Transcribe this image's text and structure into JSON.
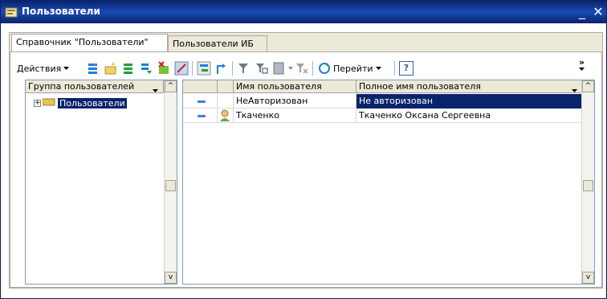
{
  "window": {
    "title": "Пользователи",
    "minimize": "_",
    "close": "✕"
  },
  "tabs": [
    {
      "label": "Справочник \"Пользователи\"",
      "active": true
    },
    {
      "label": "Пользователи ИБ",
      "active": false
    }
  ],
  "toolbar": {
    "actions_label": "Действия",
    "goto_label": "Перейти",
    "help_label": "?",
    "overflow": "»",
    "icons": [
      "add-group-icon",
      "add-item-icon",
      "add-child-icon",
      "move-icon",
      "delete-icon",
      "edit-icon",
      "hierarchy-icon",
      "level-up-icon",
      "filter-icon",
      "filter-value-icon",
      "filter-history-icon",
      "clear-filter-icon",
      "refresh-icon"
    ]
  },
  "tree": {
    "header": "Группа пользователей",
    "items": [
      {
        "label": "Пользователи",
        "expanded": false,
        "selected": true
      }
    ]
  },
  "grid": {
    "columns": [
      "",
      "",
      "Имя пользователя",
      "Полное имя пользователя"
    ],
    "rows": [
      {
        "name": "НеАвторизован",
        "full_name": "Не авторизован",
        "has_avatar": false,
        "selected": true
      },
      {
        "name": "Ткаченко",
        "full_name": "Ткаченко Оксана Сергеевна",
        "has_avatar": true,
        "selected": false
      }
    ]
  },
  "colors": {
    "titlebar": "#0a246a",
    "selection": "#0a246a",
    "panel_bg": "#ece9d8"
  }
}
